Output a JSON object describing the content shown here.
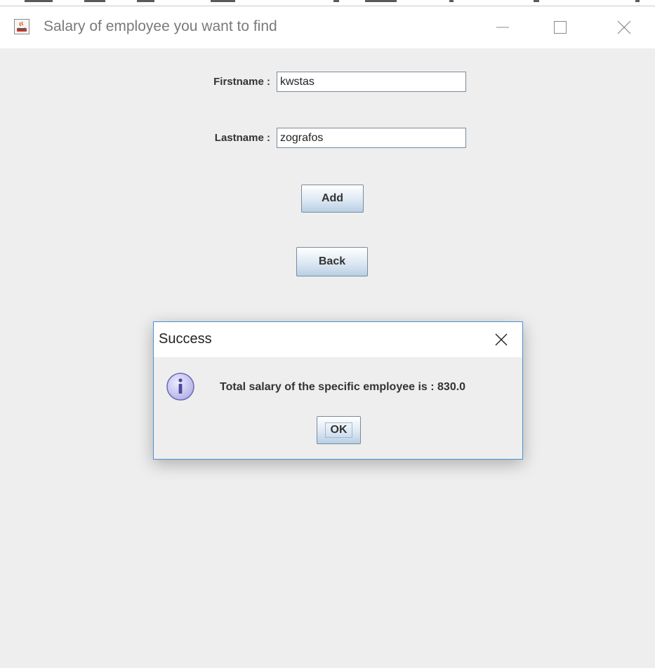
{
  "window": {
    "title": "Salary of employee you want to find",
    "icon": "java-coffee-icon",
    "controls": [
      "minimize-icon",
      "maximize-icon",
      "close-icon"
    ]
  },
  "form": {
    "firstname_label": "Firstname :",
    "firstname_value": "kwstas",
    "lastname_label": "Lastname :",
    "lastname_value": "zografos",
    "add_label": "Add",
    "back_label": "Back"
  },
  "dialog": {
    "title": "Success",
    "icon": "info-icon",
    "message": "Total salary of the specific employee is : 830.0",
    "ok_label": "OK",
    "close_icon": "close-icon"
  },
  "colors": {
    "background": "#eeeeee",
    "titlebar": "#ffffff",
    "dialog_border": "#4a8fd6",
    "button_gradient_bottom": "#b8cfe5",
    "info_icon_fill": "#c8c8f0"
  }
}
